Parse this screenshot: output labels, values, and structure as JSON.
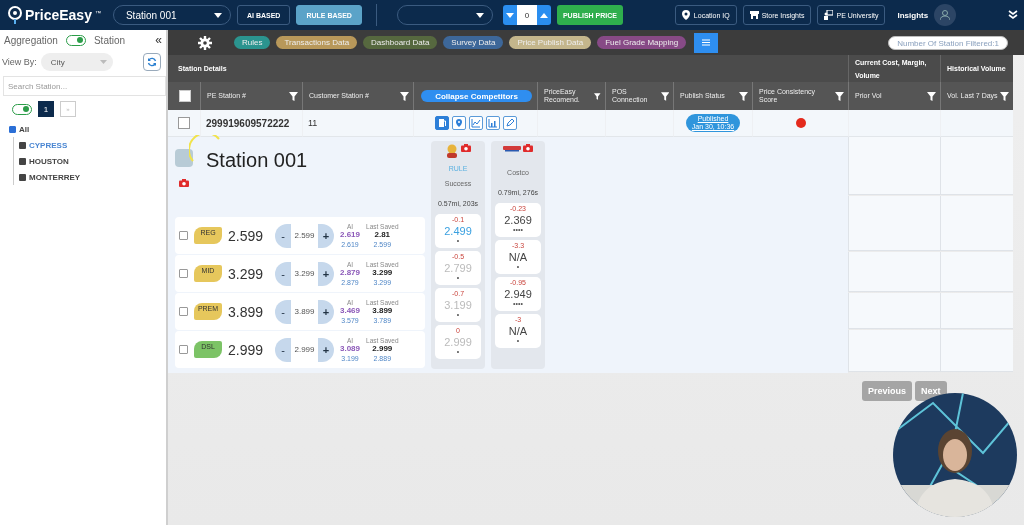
{
  "top_bar": {
    "brand": "PriceEasy",
    "trademark": "™",
    "station_select": "Station 001",
    "modes": [
      {
        "label": "AI BASED",
        "selected": false
      },
      {
        "label": "RULE BASED",
        "selected": true
      }
    ],
    "stepper_value": "0",
    "publish_button": "PUBLISH PRICE",
    "links": [
      {
        "label": "Location IQ"
      },
      {
        "label": "Store Insights"
      },
      {
        "label": "PE University"
      }
    ],
    "insights": "Insights"
  },
  "sidebar": {
    "aggregation_label": "Aggregation",
    "aggregation_on": true,
    "station_label": "Station",
    "collapse_glyph": "«",
    "view_by_label": "View By:",
    "view_by_value": "City",
    "search_placeholder": "Search Station...",
    "tree_toggle_on": true,
    "pages": [
      {
        "label": "1",
        "selected": true
      },
      {
        "label": "»",
        "selected": false
      }
    ],
    "tree": [
      {
        "label": "All",
        "checked": true,
        "selected": false,
        "children": [
          {
            "label": "CYPRESS",
            "checked": false,
            "selected": true
          },
          {
            "label": "HOUSTON",
            "checked": false,
            "selected": false
          },
          {
            "label": "MONTERREY",
            "checked": false,
            "selected": false
          }
        ]
      }
    ]
  },
  "toolbar": {
    "chips": [
      {
        "label": "Rules",
        "color": "#2b948f"
      },
      {
        "label": "Transactions Data",
        "color": "#b8985a"
      },
      {
        "label": "Dashboard Data",
        "color": "#56683f"
      },
      {
        "label": "Survey Data",
        "color": "#3d6799"
      },
      {
        "label": "Price Publish Data",
        "color": "#c4b68c"
      },
      {
        "label": "Fuel Grade Mapping",
        "color": "#874a86"
      }
    ],
    "filter_count": "Number Of Station Filtered:1"
  },
  "table": {
    "groups": [
      {
        "label": "Station Details"
      },
      {
        "label": "Current Cost, Margin, Volume"
      },
      {
        "label": "Historical Volume"
      }
    ],
    "columns": [
      {
        "kind": "filter",
        "label": "PE Station #"
      },
      {
        "kind": "filter",
        "label": "Customer Station #"
      },
      {
        "kind": "button",
        "label": "Collapse Competitors"
      },
      {
        "kind": "filter",
        "label": "PriceEasy Recomend."
      },
      {
        "kind": "filter",
        "label": "POS Connection"
      },
      {
        "kind": "filter",
        "label": "Publish Status"
      },
      {
        "kind": "filter",
        "label": "Price Consistency Score"
      },
      {
        "kind": "filter",
        "label": "Prior Vol"
      },
      {
        "kind": "filter",
        "label": "Vol. Last 7 Days"
      }
    ],
    "header_checked": false,
    "rows": [
      {
        "checked": false,
        "pe_station": "299919609572222",
        "customer_station": "11",
        "publish_status": "Published",
        "publish_date": "Jan 30, 10:36",
        "consistency_score": {
          "color": "#e42a1d"
        }
      }
    ]
  },
  "station_panel": {
    "title": "Station 001",
    "grades": [
      {
        "grade": "REG",
        "color": "#e6c75c",
        "checked": false,
        "price": "2.599",
        "decrement": "-",
        "stepper_value": "2.599",
        "increment": "+",
        "ai_label": "AI",
        "ai_price": "2.619",
        "last_saved_label": "Last Saved",
        "last_saved_price": "2.81",
        "ai_sub": "2.619",
        "last_saved_sub": "2.599"
      },
      {
        "grade": "MID",
        "color": "#e6c75c",
        "checked": false,
        "price": "3.299",
        "decrement": "-",
        "stepper_value": "3.299",
        "increment": "+",
        "ai_label": "AI",
        "ai_price": "2.879",
        "last_saved_label": "Last Saved",
        "last_saved_price": "3.299",
        "ai_sub": "2.879",
        "last_saved_sub": "3.299"
      },
      {
        "grade": "PREM",
        "color": "#e6c75c",
        "checked": false,
        "price": "3.899",
        "decrement": "-",
        "stepper_value": "3.899",
        "increment": "+",
        "ai_label": "AI",
        "ai_price": "3.469",
        "last_saved_label": "Last Saved",
        "last_saved_price": "3.899",
        "ai_sub": "3.579",
        "last_saved_sub": "3.789"
      },
      {
        "grade": "DSL",
        "color": "#7cc366",
        "checked": false,
        "price": "2.999",
        "decrement": "-",
        "stepper_value": "2.999",
        "increment": "+",
        "ai_label": "AI",
        "ai_price": "3.089",
        "last_saved_label": "Last Saved",
        "last_saved_price": "2.999",
        "ai_sub": "3.199",
        "last_saved_sub": "2.889"
      }
    ],
    "competitors": [
      {
        "kind": "mascot",
        "tag": "RULE",
        "name": "Success",
        "distance": "0.57mi, 203s",
        "prices": [
          {
            "diff": "-0.1",
            "price": "2.499",
            "kind": "active",
            "dots": "•"
          },
          {
            "diff": "-0.5",
            "price": "2.799",
            "kind": "muted",
            "dots": "•"
          },
          {
            "diff": "-0.7",
            "price": "3.199",
            "kind": "muted",
            "dots": "•"
          },
          {
            "diff": "0",
            "price": "2.999",
            "kind": "muted",
            "dots": "•"
          }
        ]
      },
      {
        "kind": "wordmark",
        "name": "Costco",
        "distance": "0.79mi, 276s",
        "prices": [
          {
            "diff": "-0.23",
            "price": "2.369",
            "kind": "plain",
            "dots": "••••"
          },
          {
            "diff": "-3.3",
            "price": "N/A",
            "kind": "plain",
            "dots": "•"
          },
          {
            "diff": "-0.95",
            "price": "2.949",
            "kind": "plain",
            "dots": "••••"
          },
          {
            "diff": "-3",
            "price": "N/A",
            "kind": "plain",
            "dots": "•"
          }
        ]
      }
    ]
  },
  "pagination": {
    "previous": "Previous",
    "next": "Next",
    "previous_disabled": true,
    "next_disabled": true
  }
}
